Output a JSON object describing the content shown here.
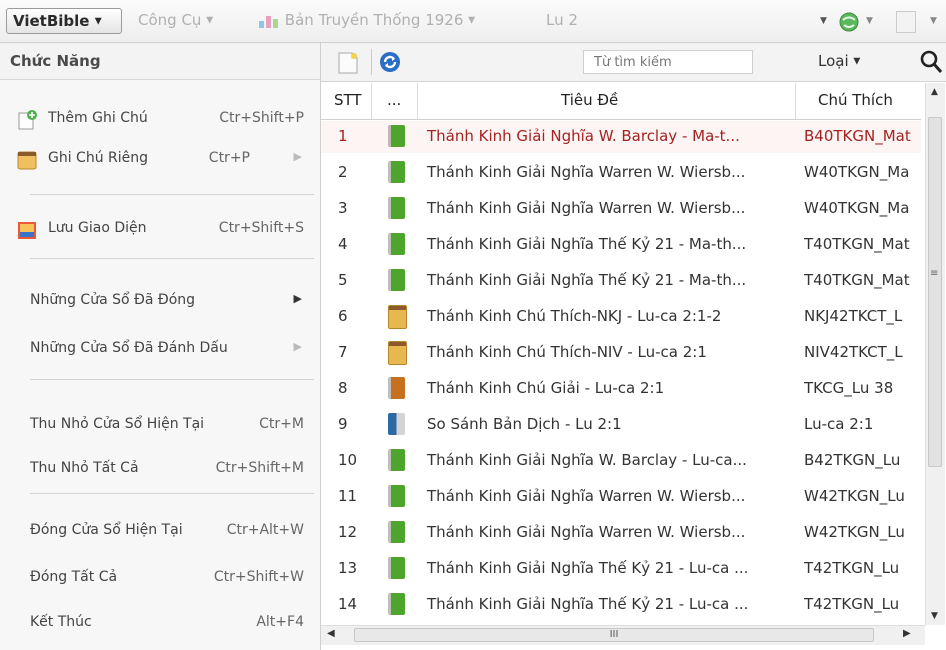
{
  "toolbar": {
    "app_menu": "VietBible",
    "tools": "Công Cụ",
    "version": "Bản Truyền Thống 1926",
    "reference": "Lu 2"
  },
  "menu": {
    "title": "Chức Năng",
    "items": [
      {
        "label": "Thêm Ghi Chú",
        "shortcut": "Ctr+Shift+P"
      },
      {
        "label": "Ghi Chú Riêng",
        "shortcut": "Ctr+P"
      },
      {
        "label": "Lưu Giao Diện",
        "shortcut": "Ctr+Shift+S"
      },
      {
        "label": "Những Cửa Sổ Đã Đóng",
        "shortcut": ""
      },
      {
        "label": "Những Cửa Sổ Đã Đánh Dấu",
        "shortcut": ""
      },
      {
        "label": "Thu Nhỏ Cửa Sổ Hiện Tại",
        "shortcut": "Ctr+M"
      },
      {
        "label": "Thu Nhỏ Tất Cả",
        "shortcut": "Ctr+Shift+M"
      },
      {
        "label": "Đóng Cửa Sổ Hiện Tại",
        "shortcut": "Ctr+Alt+W"
      },
      {
        "label": "Đóng Tất Cả",
        "shortcut": "Ctr+Shift+W"
      },
      {
        "label": "Kết Thúc",
        "shortcut": "Alt+F4"
      }
    ]
  },
  "panel": {
    "search_placeholder": "Từ tìm kiếm",
    "type_label": "Loại",
    "columns": {
      "num": "STT",
      "icon": "...",
      "title": "Tiêu Đề",
      "note": "Chú Thích"
    },
    "hscroll_grip": "III",
    "rows": [
      {
        "n": "1",
        "icon": "green-book",
        "title": "Thánh Kinh Giải Nghĩa W. Barclay - Ma-t...",
        "note": "B40TKGN_Mat"
      },
      {
        "n": "2",
        "icon": "green-book",
        "title": "Thánh Kinh Giải Nghĩa Warren W. Wiersb...",
        "note": "W40TKGN_Ma"
      },
      {
        "n": "3",
        "icon": "green-book",
        "title": "Thánh Kinh Giải Nghĩa Warren W. Wiersb...",
        "note": "W40TKGN_Ma"
      },
      {
        "n": "4",
        "icon": "green-book",
        "title": "Thánh Kinh Giải Nghĩa Thế Kỷ 21 - Ma-th...",
        "note": "T40TKGN_Mat"
      },
      {
        "n": "5",
        "icon": "green-book",
        "title": "Thánh Kinh Giải Nghĩa Thế Kỷ 21 - Ma-th...",
        "note": "T40TKGN_Mat"
      },
      {
        "n": "6",
        "icon": "note-book",
        "title": "Thánh Kinh Chú Thích-NKJ - Lu-ca 2:1-2",
        "note": "NKJ42TKCT_L"
      },
      {
        "n": "7",
        "icon": "note-book",
        "title": "Thánh Kinh Chú Thích-NIV - Lu-ca 2:1",
        "note": "NIV42TKCT_L"
      },
      {
        "n": "8",
        "icon": "brown-book",
        "title": "Thánh Kinh Chú Giải - Lu-ca 2:1",
        "note": "TKCG_Lu 38"
      },
      {
        "n": "9",
        "icon": "compare-book",
        "title": "So Sánh Bản Dịch - Lu 2:1",
        "note": "Lu-ca 2:1"
      },
      {
        "n": "10",
        "icon": "green-book",
        "title": "Thánh Kinh Giải Nghĩa W. Barclay - Lu-ca...",
        "note": "B42TKGN_Lu"
      },
      {
        "n": "11",
        "icon": "green-book",
        "title": "Thánh Kinh Giải Nghĩa Warren W. Wiersb...",
        "note": "W42TKGN_Lu"
      },
      {
        "n": "12",
        "icon": "green-book",
        "title": "Thánh Kinh Giải Nghĩa Warren W. Wiersb...",
        "note": "W42TKGN_Lu"
      },
      {
        "n": "13",
        "icon": "green-book",
        "title": "Thánh Kinh Giải Nghĩa Thế Kỷ 21 - Lu-ca ...",
        "note": "T42TKGN_Lu"
      },
      {
        "n": "14",
        "icon": "green-book",
        "title": "Thánh Kinh Giải Nghĩa Thế Kỷ 21 - Lu-ca ...",
        "note": "T42TKGN_Lu"
      }
    ]
  },
  "colors": {
    "selected_row_text": "#a52222",
    "green_book": "#4fa52c",
    "note_book": "#e8b850",
    "brown_book": "#c7701f",
    "compare_book": "#2c6aa5"
  }
}
